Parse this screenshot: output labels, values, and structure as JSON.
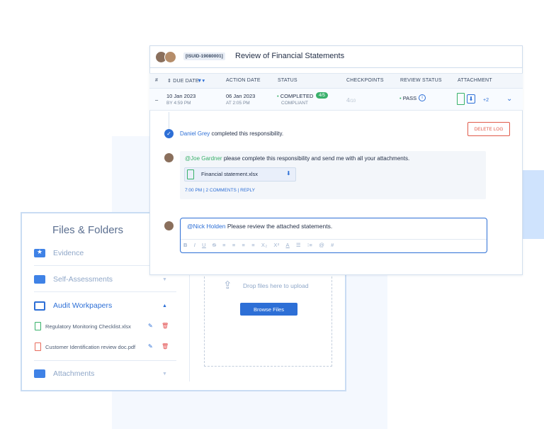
{
  "files_panel": {
    "title": "Files & Folders",
    "folders": [
      {
        "label": "Evidence",
        "icon": "star-folder-icon"
      },
      {
        "label": "Self-Assessments",
        "icon": "folder-icon",
        "caret": "▼"
      },
      {
        "label": "Audit Workpapers",
        "icon": "folder-outline-icon",
        "caret": "▲"
      },
      {
        "label": "Attachments",
        "icon": "folder-icon",
        "caret": "▼"
      }
    ],
    "files": [
      {
        "name": "Regulatory Monitoring Checklist.xlsx",
        "type": "xls"
      },
      {
        "name": "Customer Identification review doc.pdf",
        "type": "pdf"
      }
    ],
    "drop_text": "Drop files here to upload",
    "browse_label": "Browse Files"
  },
  "card": {
    "id": "[ISUID-19080001]",
    "title": "Review of Financial Statements"
  },
  "table": {
    "headers": {
      "num": "#",
      "due_date": "DUE DATE",
      "action_date": "ACTION DATE",
      "status": "STATUS",
      "checkpoints": "CHECKPOINTS",
      "review_status": "REVIEW STATUS",
      "attachment": "ATTACHMENT"
    },
    "row": {
      "expand": "–",
      "due_date": "10 Jan 2023",
      "due_time": "BY 4:59 PM",
      "action_date": "06 Jan 2023",
      "action_time": "AT 2:05 PM",
      "status": "COMPLETED",
      "status_count": "4/5",
      "status_sub": "COMPLIANT",
      "checkpoints": "4",
      "checkpoints_total": "/10",
      "review_status": "PASS",
      "attachment_more": "+2"
    }
  },
  "activity": {
    "actor": "Daniel Grey",
    "text": " completed this responsibility.",
    "delete_label": "DELETE LOG"
  },
  "comment": {
    "mention": "@Joe Gardner",
    "text": " please complete this responsibility and send me with all your attachments.",
    "file_name": "Financial statement.xlsx",
    "meta": "7:00 PM  |  2 COMMENTS  |  REPLY"
  },
  "reply": {
    "mention": "@Nick Holden",
    "text": " Please review the attached statements.",
    "toolbar": [
      "B",
      "I",
      "U",
      "S",
      "≡",
      "≡",
      "≡",
      "≡",
      "X₂",
      "X²",
      "A",
      "☰",
      "⁝≡",
      "@",
      "#"
    ]
  },
  "colors": {
    "accent": "#2d6fd6",
    "success": "#3ab06b",
    "danger": "#e05a4a",
    "light_blue_panel": "#cfe3fd"
  }
}
